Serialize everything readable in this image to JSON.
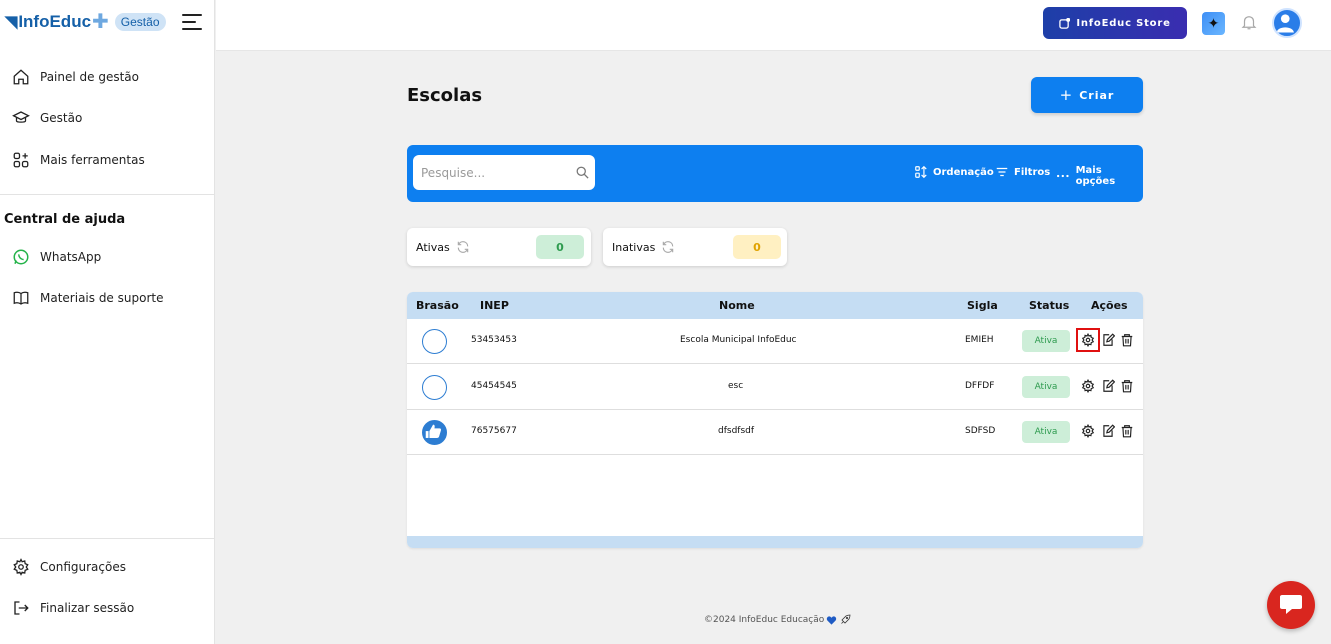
{
  "brand": {
    "name": "InfoEduc",
    "badge": "Gestão"
  },
  "sidebar": {
    "items": [
      {
        "label": "Painel de gestão",
        "icon": "home-icon"
      },
      {
        "label": "Gestão",
        "icon": "graduation-cap-icon"
      },
      {
        "label": "Mais ferramentas",
        "icon": "grid-plus-icon"
      }
    ],
    "help_title": "Central de ajuda",
    "help_items": [
      {
        "label": "WhatsApp",
        "icon": "whatsapp-icon"
      },
      {
        "label": "Materiais de suporte",
        "icon": "book-icon"
      }
    ],
    "bottom_items": [
      {
        "label": "Configurações",
        "icon": "gear-icon"
      },
      {
        "label": "Finalizar sessão",
        "icon": "logout-icon"
      }
    ]
  },
  "topbar": {
    "store_label": "InfoEduc Store"
  },
  "page": {
    "title": "Escolas",
    "create_label": "Criar"
  },
  "filters": {
    "search_placeholder": "Pesquise...",
    "sort_label": "Ordenação",
    "filter_label": "Filtros",
    "more_label": "Mais opções"
  },
  "stats": {
    "active": {
      "label": "Ativas",
      "count": "0"
    },
    "inactive": {
      "label": "Inativas",
      "count": "0"
    }
  },
  "table": {
    "headers": {
      "crest": "Brasão",
      "inep": "INEP",
      "name": "Nome",
      "acronym": "Sigla",
      "status": "Status",
      "actions": "Ações"
    },
    "rows": [
      {
        "inep": "53453453",
        "name": "Escola Municipal InfoEduc",
        "acronym": "EMIEH",
        "status": "Ativa"
      },
      {
        "inep": "45454545",
        "name": "esc",
        "acronym": "DFFDF",
        "status": "Ativa"
      },
      {
        "inep": "76575677",
        "name": "dfsdfsdf",
        "acronym": "SDFSD",
        "status": "Ativa"
      }
    ]
  },
  "footer": {
    "text": "©2024 InfoEduc Educação"
  },
  "colors": {
    "primary": "#0d7ff0",
    "store": "#1d3fa8",
    "active_badge": "#cdeed8",
    "inactive_badge": "#fff0c2",
    "chat": "#d9261f",
    "highlight": "#e01010"
  }
}
